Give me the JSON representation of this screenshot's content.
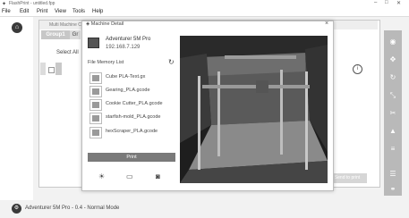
{
  "window": {
    "title": "FlashPrint - untitled.fpp",
    "controls": [
      "–",
      "□",
      "✕"
    ]
  },
  "menu": [
    "File",
    "Edit",
    "Print",
    "View",
    "Tools",
    "Help"
  ],
  "background_dialog": {
    "title": "Multi Machine Co...",
    "tabs": [
      "Group1",
      "Gr"
    ],
    "select_all": "Select All",
    "action_button": "Send to print"
  },
  "machine_detail": {
    "title": "Machine Detail",
    "printer_name": "Adventurer 5M Pro",
    "printer_ip": "192.168.7.129",
    "file_list_label": "File Memory List",
    "files": [
      "Cube PLA-Text.gx",
      "Gearing_PLA.gcode",
      "Cookie Cutter_PLA.gcode",
      "starfish-mold_PLA.gcode",
      "hexScraper_PLA.gcode"
    ],
    "print_label": "Print",
    "tools": [
      "light-bulb-icon",
      "video-icon",
      "camera-icon"
    ]
  },
  "status": {
    "text": "Adventurer 5M Pro - 0.4 - Normal Mode"
  },
  "colors": {
    "print_button": "#7a7a7a",
    "group_tab": "#c7c7c7",
    "right_toolbar": "#b9b9b9"
  }
}
